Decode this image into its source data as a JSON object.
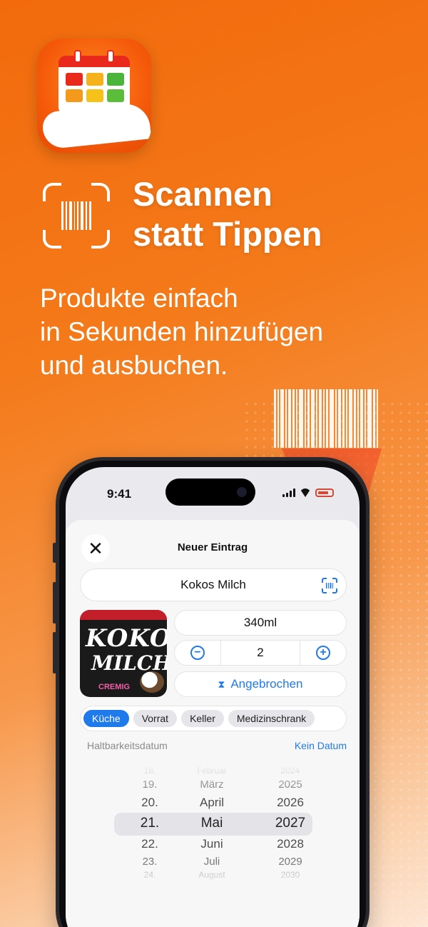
{
  "promo": {
    "headline_line1": "Scannen",
    "headline_line2": "statt Tippen",
    "subline_line1": "Produkte einfach",
    "subline_line2": "in Sekunden hinzufügen",
    "subline_line3": "und ausbuchen."
  },
  "colors": {
    "accent": "#1f7aeb",
    "brand_orange": "#f26a0c",
    "calendar_red": "#e8291b"
  },
  "status_bar": {
    "time": "9:41"
  },
  "sheet": {
    "title": "Neuer Eintrag",
    "close_icon": "close-icon",
    "product_name": "Kokos Milch",
    "scan_icon": "barcode-scan-icon",
    "quantity_text": "340ml",
    "count": "2",
    "opened_label": "Angebrochen",
    "product_image": {
      "line1": "KOKOS",
      "line2": "MILCH",
      "line3": "CREMIG"
    },
    "locations": [
      "Küche",
      "Vorrat",
      "Keller",
      "Medizinschrank"
    ],
    "selected_location": "Küche",
    "date_label": "Haltbarkeitsdatum",
    "no_date_label": "Kein Datum",
    "picker": {
      "days": [
        "18.",
        "19.",
        "20.",
        "21.",
        "22.",
        "23.",
        "24."
      ],
      "months": [
        "Februar",
        "März",
        "April",
        "Mai",
        "Juni",
        "Juli",
        "August"
      ],
      "years": [
        "2024",
        "2025",
        "2026",
        "2027",
        "2028",
        "2029",
        "2030"
      ],
      "selected_day": "21.",
      "selected_month": "Mai",
      "selected_year": "2027"
    }
  }
}
